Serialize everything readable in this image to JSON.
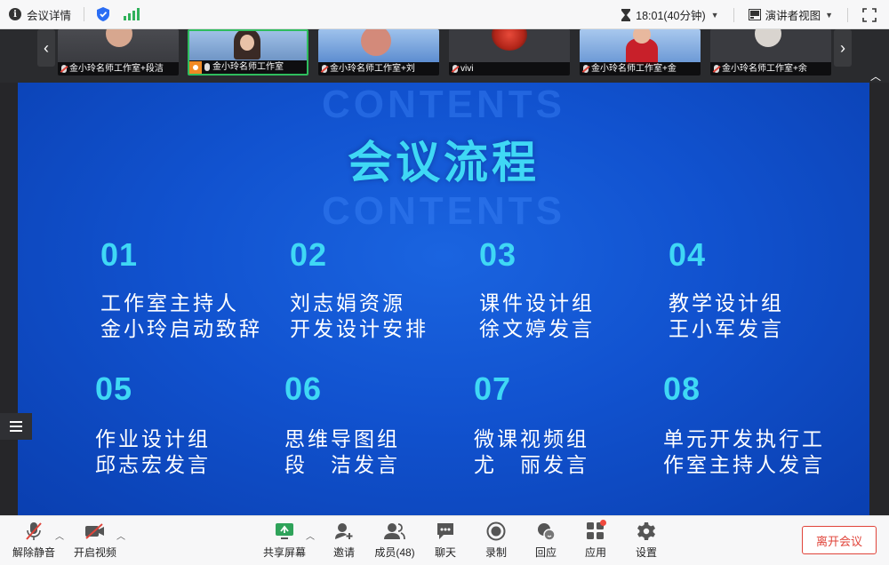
{
  "topbar": {
    "meeting_details_label": "会议详情",
    "time_text": "18:01(40分钟)",
    "view_label": "演讲者视图"
  },
  "gallery": {
    "participants": [
      {
        "name": "金小玲名师工作室+段洁",
        "muted": true,
        "active": false,
        "host": false
      },
      {
        "name": "金小玲名师工作室",
        "muted": false,
        "active": true,
        "host": true
      },
      {
        "name": "金小玲名师工作室+刘",
        "muted": true,
        "active": false,
        "host": false
      },
      {
        "name": "vivi",
        "muted": true,
        "active": false,
        "host": false
      },
      {
        "name": "金小玲名师工作室+金",
        "muted": true,
        "active": false,
        "host": false
      },
      {
        "name": "金小玲名师工作室+余",
        "muted": true,
        "active": false,
        "host": false
      }
    ]
  },
  "slide": {
    "ghost_text": "CONTENTS",
    "title": "会议流程",
    "items": [
      {
        "num": "01",
        "line1": "工作室主持人",
        "line2": "金小玲启动致辞"
      },
      {
        "num": "02",
        "line1": "刘志娟资源",
        "line2": "开发设计安排"
      },
      {
        "num": "03",
        "line1": "课件设计组",
        "line2": "徐文婷发言"
      },
      {
        "num": "04",
        "line1": "教学设计组",
        "line2": "王小军发言"
      },
      {
        "num": "05",
        "line1": "作业设计组",
        "line2": "邱志宏发言"
      },
      {
        "num": "06",
        "line1": "思维导图组",
        "line2": "段　洁发言"
      },
      {
        "num": "07",
        "line1": "微课视频组",
        "line2": "尤　丽发言"
      },
      {
        "num": "08",
        "line1": "单元开发执行工",
        "line2": "作室主持人发言"
      }
    ]
  },
  "toolbar": {
    "unmute": "解除静音",
    "start_video": "开启视频",
    "share_screen": "共享屏幕",
    "invite": "邀请",
    "members": "成员(48)",
    "chat": "聊天",
    "record": "录制",
    "replay": "回应",
    "apps": "应用",
    "settings": "设置",
    "leave": "离开会议"
  },
  "colors": {
    "slide_blue": "#1152cf",
    "accent_cyan": "#3fd8f5",
    "active_green": "#2fbd5e",
    "danger_red": "#e0443a"
  }
}
